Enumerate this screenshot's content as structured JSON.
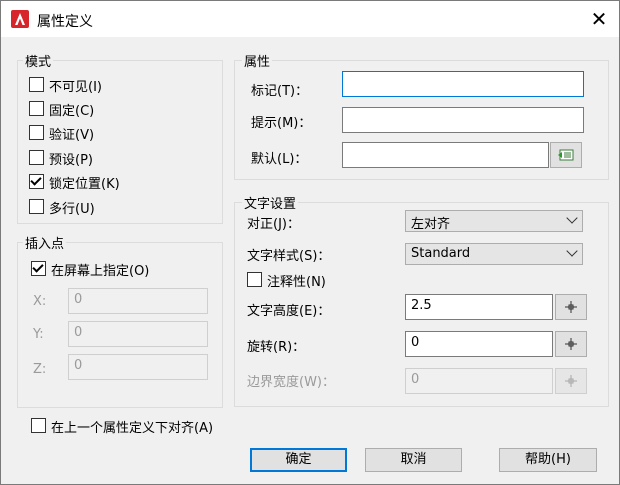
{
  "window": {
    "title": "属性定义",
    "close_glyph": "✕"
  },
  "mode": {
    "legend": "模式",
    "items": [
      {
        "label": "不可见(I)",
        "checked": false
      },
      {
        "label": "固定(C)",
        "checked": false
      },
      {
        "label": "验证(V)",
        "checked": false
      },
      {
        "label": "预设(P)",
        "checked": false
      },
      {
        "label": "锁定位置(K)",
        "checked": true
      },
      {
        "label": "多行(U)",
        "checked": false
      }
    ]
  },
  "attribute": {
    "legend": "属性",
    "tag_label": "标记(T)：",
    "tag_value": "",
    "prompt_label": "提示(M)：",
    "prompt_value": "",
    "default_label": "默认(L)：",
    "default_value": "",
    "insert_field_icon": "insert-field-icon"
  },
  "insertion": {
    "legend": "插入点",
    "specify_on_screen": {
      "label": "在屏幕上指定(O)",
      "checked": true
    },
    "x_label": "X:",
    "x_value": "0",
    "y_label": "Y:",
    "y_value": "0",
    "z_label": "Z:",
    "z_value": "0"
  },
  "text_settings": {
    "legend": "文字设置",
    "justify_label": "对正(J)：",
    "justify_value": "左对齐",
    "style_label": "文字样式(S)：",
    "style_value": "Standard",
    "annotative": {
      "label": "注释性(N)",
      "checked": false
    },
    "height_label": "文字高度(E)：",
    "height_value": "2.5",
    "rotation_label": "旋转(R)：",
    "rotation_value": "0",
    "boundary_label": "边界宽度(W)：",
    "boundary_value": "0"
  },
  "align_below": {
    "label": "在上一个属性定义下对齐(A)",
    "checked": false
  },
  "buttons": {
    "ok": "确定",
    "cancel": "取消",
    "help": "帮助(H)"
  },
  "colors": {
    "accent": "#0078d7",
    "app_icon": "#d6262b"
  }
}
